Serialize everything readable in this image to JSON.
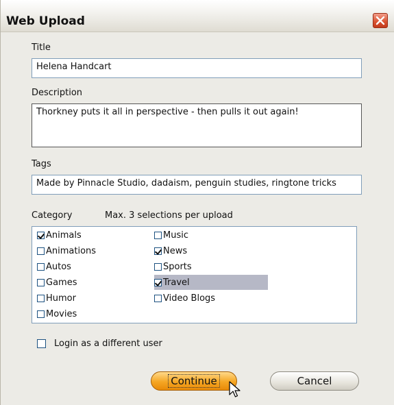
{
  "window": {
    "title": "Web Upload"
  },
  "title_field": {
    "label": "Title",
    "value": "Helena Handcart"
  },
  "description_field": {
    "label": "Description",
    "value": "Thorkney puts it all in perspective - then pulls it out again!"
  },
  "tags_field": {
    "label": "Tags",
    "value": "Made by Pinnacle Studio, dadaism, penguin studies, ringtone tricks"
  },
  "category": {
    "label": "Category",
    "hint": "Max. 3 selections per upload",
    "items": [
      {
        "label": "Animals",
        "checked": true
      },
      {
        "label": "Animations",
        "checked": false
      },
      {
        "label": "Autos",
        "checked": false
      },
      {
        "label": "Games",
        "checked": false
      },
      {
        "label": "Humor",
        "checked": false
      },
      {
        "label": "Movies",
        "checked": false
      },
      {
        "label": "Music",
        "checked": false
      },
      {
        "label": "News",
        "checked": true
      },
      {
        "label": "Sports",
        "checked": false
      },
      {
        "label": "Travel",
        "checked": true
      },
      {
        "label": "Video Blogs",
        "checked": false
      }
    ]
  },
  "login_option": {
    "label": "Login as a different user",
    "checked": false
  },
  "buttons": {
    "continue": "Continue",
    "cancel": "Cancel"
  },
  "icons": {
    "close": "close-icon",
    "cursor": "mouse-cursor-icon"
  }
}
